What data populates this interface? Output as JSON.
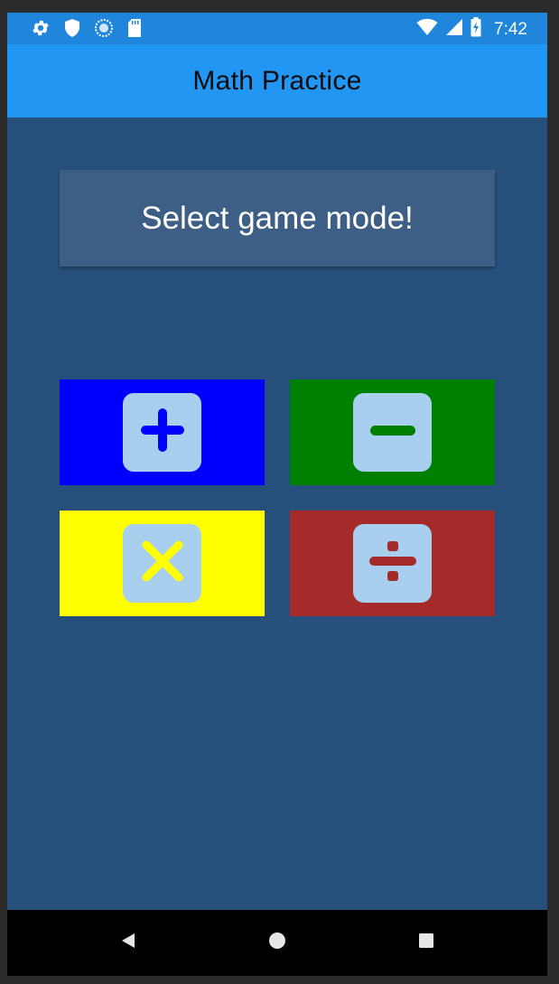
{
  "status_bar": {
    "left_icons": [
      "settings-gear-icon",
      "shield-icon",
      "sync-circle-icon",
      "sd-card-icon"
    ],
    "right_icons": [
      "wifi-icon",
      "cell-signal-icon",
      "battery-charging-icon"
    ],
    "time": "7:42"
  },
  "app_bar": {
    "title": "Math Practice"
  },
  "main": {
    "prompt": "Select game mode!",
    "modes": [
      {
        "name": "addition",
        "icon": "plus-icon",
        "tile_color": "#0000ff",
        "glyph_color": "#0000ff"
      },
      {
        "name": "subtraction",
        "icon": "minus-icon",
        "tile_color": "#008000",
        "glyph_color": "#008000"
      },
      {
        "name": "multiplication",
        "icon": "times-icon",
        "tile_color": "#ffff00",
        "glyph_color": "#ffff00"
      },
      {
        "name": "division",
        "icon": "divide-icon",
        "tile_color": "#a52a2a",
        "glyph_color": "#a52a2a"
      }
    ]
  },
  "nav_bar": {
    "buttons": [
      "back-icon",
      "home-icon",
      "recents-icon"
    ]
  },
  "colors": {
    "status_bar": "#1f86db",
    "app_bar": "#2196f3",
    "background": "#274f7b",
    "banner": "#3d5f85",
    "badge": "#a9cfee",
    "nav_bar": "#000000"
  }
}
